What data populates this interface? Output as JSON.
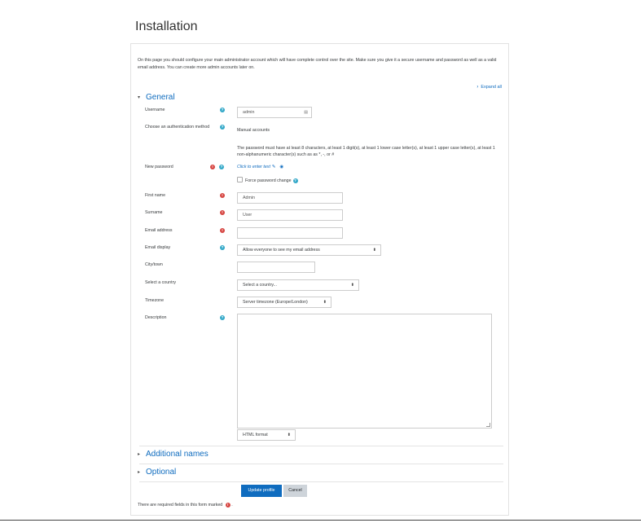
{
  "page": {
    "title": "Installation",
    "intro": "On this page you should configure your main administrator account which will have complete control over the site. Make sure you give it a secure username and password as well as a valid email address. You can create more admin accounts later on.",
    "expand_all": "Expand all"
  },
  "sections": {
    "general": "General",
    "additional_names": "Additional names",
    "optional": "Optional"
  },
  "fields": {
    "username": {
      "label": "Username",
      "value": "admin"
    },
    "auth_method": {
      "label": "Choose an authentication method",
      "value": "Manual accounts"
    },
    "password_policy": "The password must have at least 8 characters, at least 1 digit(s), at least 1 lower case letter(s), at least 1 upper case letter(s), at least 1 non-alphanumeric character(s) such as as *, -, or #",
    "new_password": {
      "label": "New password",
      "link": "Click to enter text"
    },
    "force_change": {
      "label": "Force password change"
    },
    "first_name": {
      "label": "First name",
      "value": "Admin"
    },
    "surname": {
      "label": "Surname",
      "value": "User"
    },
    "email": {
      "label": "Email address",
      "value": ""
    },
    "email_display": {
      "label": "Email display",
      "value": "Allow everyone to see my email address"
    },
    "city": {
      "label": "City/town",
      "value": ""
    },
    "country": {
      "label": "Select a country",
      "value": "Select a country..."
    },
    "timezone": {
      "label": "Timezone",
      "value": "Server timezone (Europe/London)"
    },
    "description": {
      "label": "Description",
      "format": "HTML format"
    }
  },
  "actions": {
    "update": "Update profile",
    "cancel": "Cancel"
  },
  "required_note": "There are required fields in this form marked",
  "required_note_end": ".",
  "icons": {
    "help": "question-circle-icon",
    "required": "exclamation-circle-icon"
  },
  "colors": {
    "link": "#0f6cbf",
    "help": "#33a8c8",
    "required": "#d64541"
  }
}
